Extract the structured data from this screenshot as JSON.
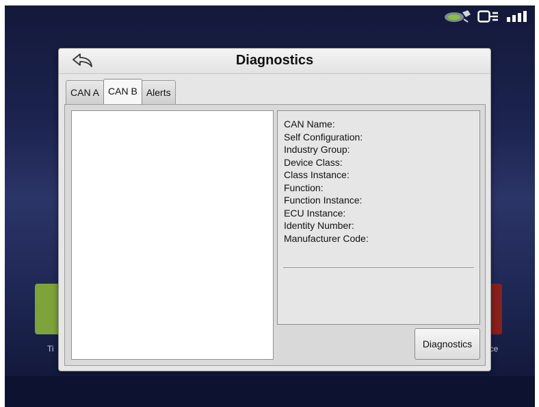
{
  "dialog": {
    "title": "Diagnostics",
    "tabs": [
      {
        "label": "CAN A",
        "active": false
      },
      {
        "label": "CAN B",
        "active": true
      },
      {
        "label": "Alerts",
        "active": false
      }
    ]
  },
  "info_fields": [
    "CAN Name:",
    "Self Configuration:",
    "Industry Group:",
    "Device Class:",
    "Class Instance:",
    "Function:",
    "Function Instance:",
    "ECU Instance:",
    "Identity Number:",
    "Manufacturer Code:"
  ],
  "buttons": {
    "diagnostics": "Diagnostics"
  },
  "background": {
    "left_tile_label": "Ti",
    "right_tile_label": "nce",
    "left_tile_color": "#7ea33a",
    "right_tile_color": "#8a1f1f"
  },
  "status_icons": [
    "gps-satellite-icon",
    "display-module-icon",
    "signal-icon"
  ]
}
